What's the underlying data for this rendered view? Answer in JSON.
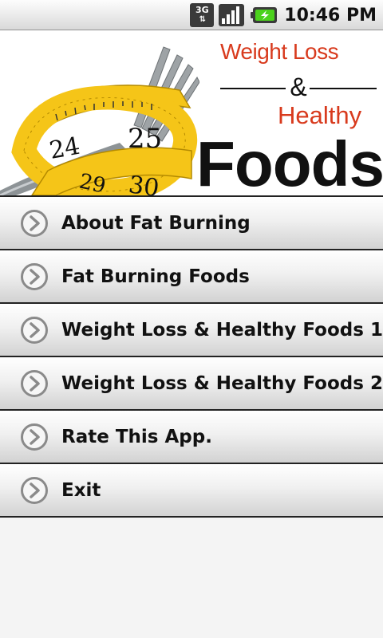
{
  "status_bar": {
    "network": "3G",
    "time": "10:46 PM",
    "icons": [
      "3g-data-icon",
      "signal-icon",
      "battery-charging-icon"
    ]
  },
  "banner": {
    "title_line1": "Weight Loss",
    "ampersand": "&",
    "title_line2": "Healthy",
    "title_line3": "Foods",
    "tape_numbers": [
      "24",
      "25",
      "29",
      "30"
    ],
    "colors": {
      "accent_red": "#d83a1d",
      "tape_yellow": "#f5c518",
      "text_dark": "#111111"
    }
  },
  "menu": {
    "items": [
      {
        "label": "About Fat Burning",
        "icon": "chevron-right-circle-icon"
      },
      {
        "label": "Fat Burning Foods",
        "icon": "chevron-right-circle-icon"
      },
      {
        "label": "Weight Loss & Healthy Foods 1",
        "icon": "chevron-right-circle-icon"
      },
      {
        "label": "Weight Loss & Healthy Foods 2",
        "icon": "chevron-right-circle-icon"
      },
      {
        "label": "Rate This App.",
        "icon": "chevron-right-circle-icon"
      },
      {
        "label": "Exit",
        "icon": "chevron-right-circle-icon"
      }
    ]
  }
}
